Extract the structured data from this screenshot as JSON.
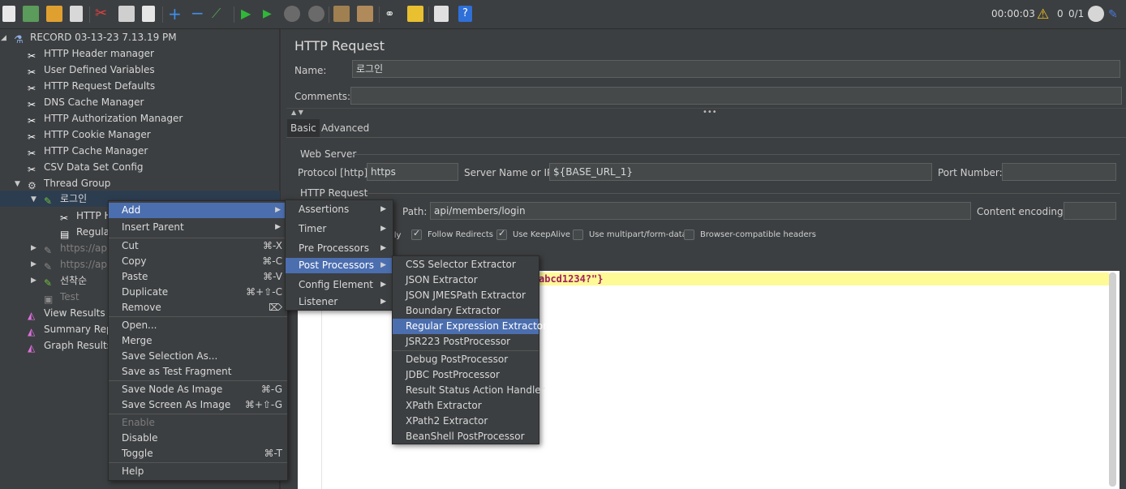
{
  "toolbar": {
    "timer": "00:00:03",
    "warnings": "0",
    "threads": "0/1",
    "icons": [
      "new-icon",
      "templates-icon",
      "open-icon",
      "save-icon",
      "cut-icon",
      "copy-icon",
      "paste-icon",
      "expand-icon",
      "collapse-icon",
      "toggle-icon",
      "start-icon",
      "start-no-pause-icon",
      "stop-icon",
      "shutdown-icon",
      "clear-icon",
      "clear-all-icon",
      "search-icon",
      "reset-search-icon",
      "function-helper-icon",
      "help-icon"
    ]
  },
  "tree": {
    "root": "RECORD 03-13-23 7.13.19 PM",
    "items": [
      "HTTP Header manager",
      "User Defined Variables",
      "HTTP Request Defaults",
      "DNS Cache Manager",
      "HTTP Authorization Manager",
      "HTTP Cookie Manager",
      "HTTP Cache Manager",
      "CSV Data Set Config",
      "Thread Group",
      "로그인",
      "HTTP H",
      "Regula",
      "https://api",
      "https://api",
      "선착순",
      "Test",
      "View Results T",
      "Summary Rep",
      "Graph Results"
    ]
  },
  "panel": {
    "title": "HTTP Request",
    "name_label": "Name:",
    "name_value": "로그인",
    "comments_label": "Comments:",
    "comments_value": "",
    "tab_basic": "Basic",
    "tab_advanced": "Advanced",
    "web_server": "Web Server",
    "protocol_label": "Protocol [http]:",
    "protocol_value": "https",
    "server_label": "Server Name or IP:",
    "server_value": "${BASE_URL_1}",
    "port_label": "Port Number:",
    "port_value": "",
    "http_request": "HTTP Request",
    "path_label": "Path:",
    "path_value": "api/members/login",
    "encoding_label": "Content encoding:",
    "encoding_value": "",
    "partial_label": "lly",
    "follow_redirects": "Follow Redirects",
    "keepalive": "Use KeepAlive",
    "multipart": "Use multipart/form-data",
    "browser_headers": "Browser-compatible headers",
    "code_snippet": "abcd1234?\"}"
  },
  "menu_main": {
    "add": "Add",
    "insert_parent": "Insert Parent",
    "cut": "Cut",
    "cut_sc": "⌘-X",
    "copy": "Copy",
    "copy_sc": "⌘-C",
    "paste": "Paste",
    "paste_sc": "⌘-V",
    "duplicate": "Duplicate",
    "duplicate_sc": "⌘+⇧-C",
    "remove": "Remove",
    "remove_sc": "⌦",
    "open": "Open...",
    "merge": "Merge",
    "save_selection": "Save Selection As...",
    "save_fragment": "Save as Test Fragment",
    "save_node_image": "Save Node As Image",
    "save_node_image_sc": "⌘-G",
    "save_screen_image": "Save Screen As Image",
    "save_screen_image_sc": "⌘+⇧-G",
    "enable": "Enable",
    "disable": "Disable",
    "toggle": "Toggle",
    "toggle_sc": "⌘-T",
    "help": "Help"
  },
  "menu_add": [
    "Assertions",
    "Timer",
    "Pre Processors",
    "Post Processors",
    "Config Element",
    "Listener"
  ],
  "menu_post": {
    "group1": [
      "CSS Selector Extractor",
      "JSON Extractor",
      "JSON JMESPath Extractor",
      "Boundary Extractor",
      "Regular Expression Extractor",
      "JSR223 PostProcessor"
    ],
    "group2": [
      "Debug PostProcessor",
      "JDBC PostProcessor",
      "Result Status Action Handler",
      "XPath Extractor",
      "XPath2 Extractor",
      "BeanShell PostProcessor"
    ]
  },
  "colors": {
    "selection": "#4b6eaf",
    "background": "#3c3f41",
    "highlight_line": "#fefa96"
  }
}
